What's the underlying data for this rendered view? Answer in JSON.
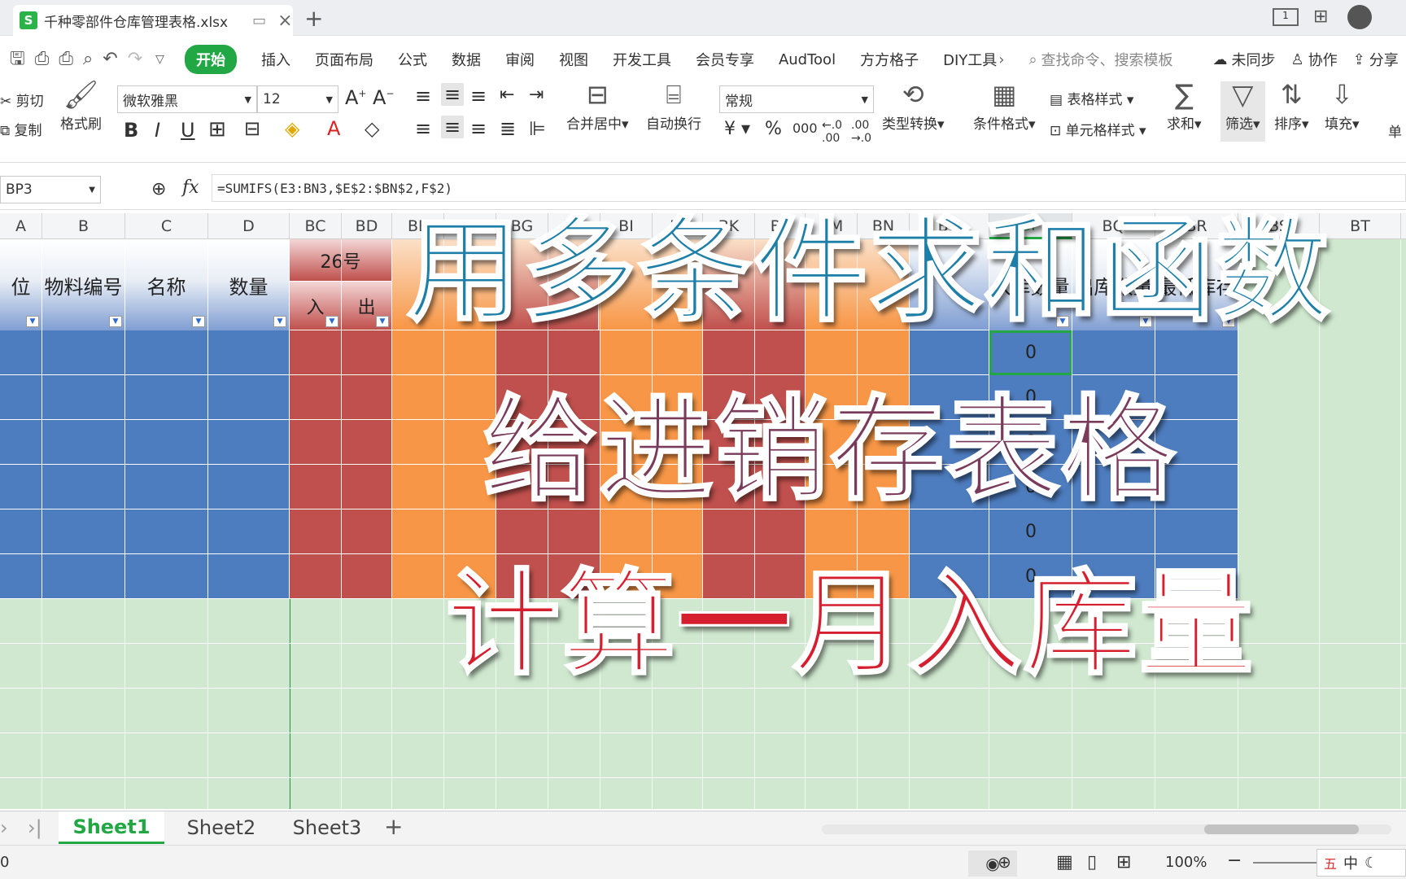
{
  "window": {
    "tab_title": "千种零部件仓库管理表格.xlsx",
    "new_tab": "+"
  },
  "menu": {
    "items": [
      "开始",
      "插入",
      "页面布局",
      "公式",
      "数据",
      "审阅",
      "视图",
      "开发工具",
      "会员专享",
      "AudTool",
      "方方格子",
      "DIY工具"
    ],
    "search": "查找命令、搜索模板",
    "sync": "未同步",
    "collab": "协作",
    "share": "分享"
  },
  "ribbon": {
    "cut": "剪切",
    "copy": "复制",
    "format_painter": "格式刷",
    "font": "微软雅黑",
    "size": "12",
    "merge": "合并居中",
    "wrap": "自动换行",
    "number_format": "常规",
    "type_convert": "类型转换",
    "cond_format": "条件格式",
    "table_style": "表格样式",
    "cell_style": "单元格样式",
    "sum": "求和",
    "filter": "筛选",
    "sort": "排序",
    "fill": "填充",
    "single": "单"
  },
  "formula": {
    "cell_ref": "BP3",
    "fx": "fx",
    "text": "=SUMIFS(E3:BN3,$E$2:$BN$2,F$2)"
  },
  "columns": [
    "A",
    "B",
    "C",
    "D",
    "BC",
    "BD",
    "BE",
    "BF",
    "BG",
    "BH",
    "BI",
    "BJ",
    "BK",
    "BL",
    "BM",
    "BN",
    "BO",
    "BP",
    "BQ",
    "BR",
    "BS",
    "BT"
  ],
  "headers": {
    "a": "位",
    "b": "物料编号",
    "c": "名称",
    "d": "数量",
    "day": "26号",
    "in": "入",
    "out": "出",
    "bp": "入库数量",
    "bq": "出库数量",
    "br": "最低库存"
  },
  "values": [
    "0",
    "0",
    "0",
    "0",
    "0",
    "0"
  ],
  "sheets": [
    "Sheet1",
    "Sheet2",
    "Sheet3"
  ],
  "status": {
    "left": "0",
    "zoom": "100%",
    "ime": "中"
  },
  "overlay": {
    "line1": "用多条件求和函数",
    "line2": "给进销存表格",
    "line3": "计算一月入库量"
  },
  "colors": {
    "blue": "#4e7dbf",
    "red": "#c0504d",
    "orange": "#f79646",
    "green_bg": "#cfe8cf"
  }
}
